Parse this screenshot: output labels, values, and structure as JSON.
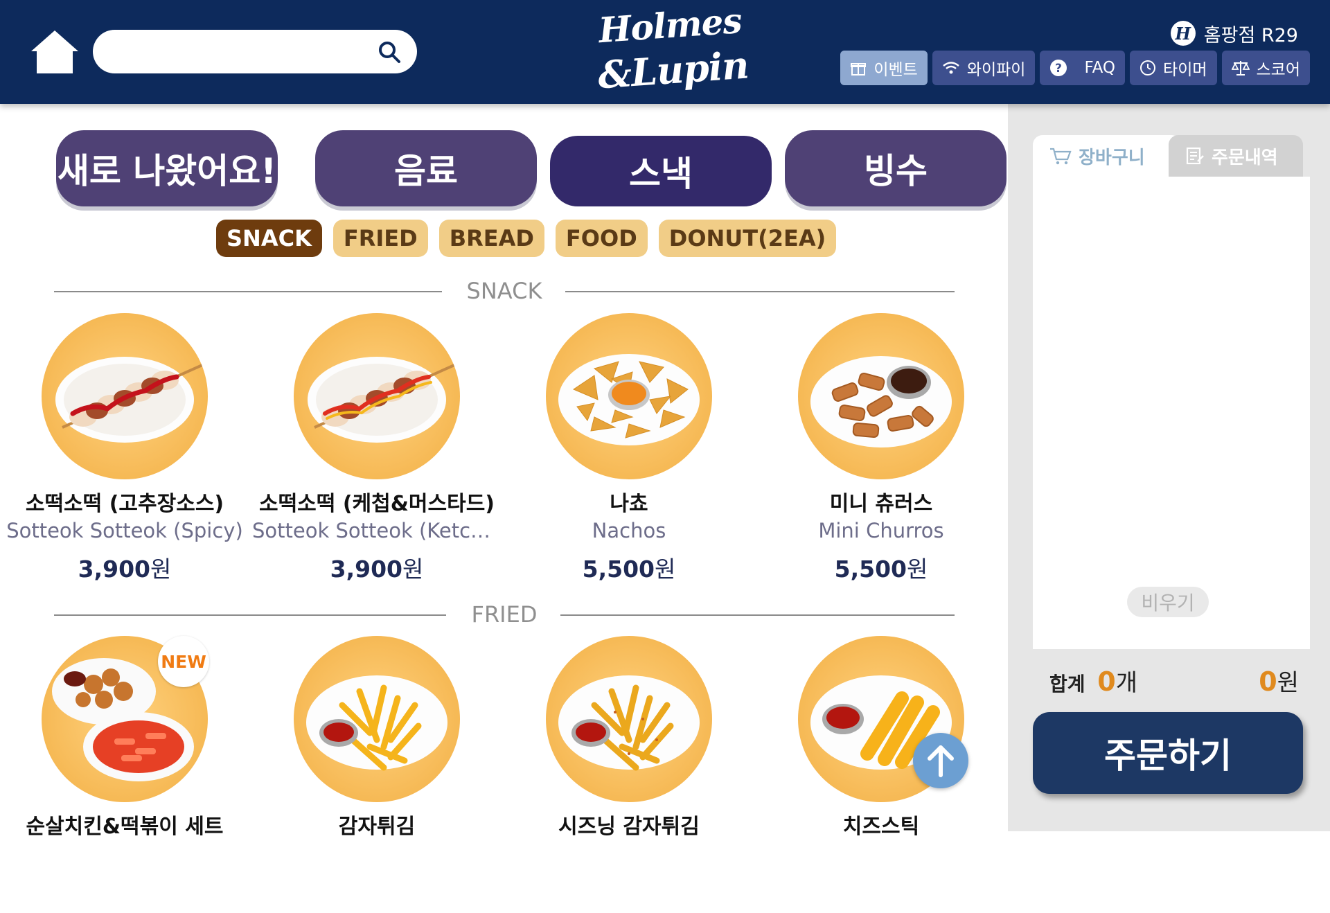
{
  "header": {
    "search": {
      "placeholder": ""
    },
    "logo": {
      "line1": "Holmes",
      "line2": "&Lupin"
    },
    "store": {
      "badge": "H",
      "name": "홈팡점 R29"
    },
    "nav": [
      {
        "label": "이벤트",
        "icon": "gift-icon",
        "active": true
      },
      {
        "label": "와이파이",
        "icon": "wifi-icon",
        "active": false
      },
      {
        "label": "FAQ",
        "icon": "question-icon",
        "active": false
      },
      {
        "label": "타이머",
        "icon": "timer-icon",
        "active": false
      },
      {
        "label": "스코어",
        "icon": "scale-icon",
        "active": false
      }
    ]
  },
  "categories": [
    {
      "label": "새로 나왔어요!",
      "active": false
    },
    {
      "label": "음료",
      "active": false
    },
    {
      "label": "스낵",
      "active": true
    },
    {
      "label": "빙수",
      "active": false
    }
  ],
  "subcategories": [
    {
      "label": "SNACK",
      "active": true
    },
    {
      "label": "FRIED",
      "active": false
    },
    {
      "label": "BREAD",
      "active": false
    },
    {
      "label": "FOOD",
      "active": false
    },
    {
      "label": "DONUT(2EA)",
      "active": false
    }
  ],
  "sections": [
    {
      "title": "SNACK",
      "items": [
        {
          "name_ko": "소떡소떡 (고추장소스)",
          "name_en": "Sotteok Sotteok (Spicy)",
          "price": "3,900",
          "currency": "원",
          "image": "sotteok"
        },
        {
          "name_ko": "소떡소떡 (케첩&머스타드)",
          "name_en": "Sotteok Sotteok (Ketchup & Mustard)",
          "price": "3,900",
          "currency": "원",
          "image": "sotteok"
        },
        {
          "name_ko": "나쵸",
          "name_en": "Nachos",
          "price": "5,500",
          "currency": "원",
          "image": "nachos"
        },
        {
          "name_ko": "미니 츄러스",
          "name_en": "Mini Churros",
          "price": "5,500",
          "currency": "원",
          "image": "churros"
        }
      ]
    },
    {
      "title": "FRIED",
      "items": [
        {
          "name_ko": "순살치킨&떡볶이 세트",
          "badge": "NEW",
          "image": "chicken"
        },
        {
          "name_ko": "감자튀김",
          "image": "fries"
        },
        {
          "name_ko": "시즈닝 감자튀김",
          "image": "fries"
        },
        {
          "name_ko": "치즈스틱",
          "image": "cheesestick"
        }
      ]
    }
  ],
  "cart": {
    "tab_cart": "장바구니",
    "tab_orders": "주문내역",
    "clear_label": "비우기",
    "total_label": "합계",
    "count": "0",
    "count_unit": "개",
    "amount": "0",
    "amount_unit": "원",
    "order_label": "주문하기"
  }
}
